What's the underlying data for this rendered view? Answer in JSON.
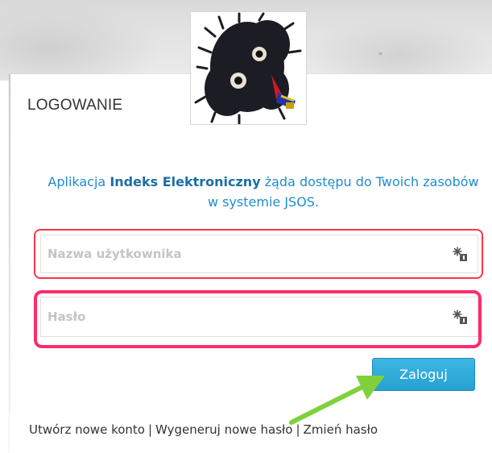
{
  "header": {
    "title": "LOGOWANIE"
  },
  "avatar": {
    "icon": "monster-avatar"
  },
  "intro": {
    "text_before": "Aplikacja ",
    "app_name": "Indeks Elektroniczny",
    "text_after": " żąda dostępu do Twoich zasobów w systemie JSOS."
  },
  "form": {
    "username_placeholder": "Nazwa użytkownika",
    "password_placeholder": "Hasło",
    "field_icon": "key-icon",
    "submit_label": "Zaloguj"
  },
  "links": {
    "create_account": "Utwórz nowe konto",
    "separator": "|",
    "generate_password": "Wygeneruj nowe hasło",
    "change_password": "Zmień hasło"
  },
  "colors": {
    "accent": "#1f8dcf",
    "button": "#2aa8d8",
    "highlight_user": "#ff3349",
    "highlight_pass": "#ff2c6a",
    "arrow": "#7fd13b"
  }
}
